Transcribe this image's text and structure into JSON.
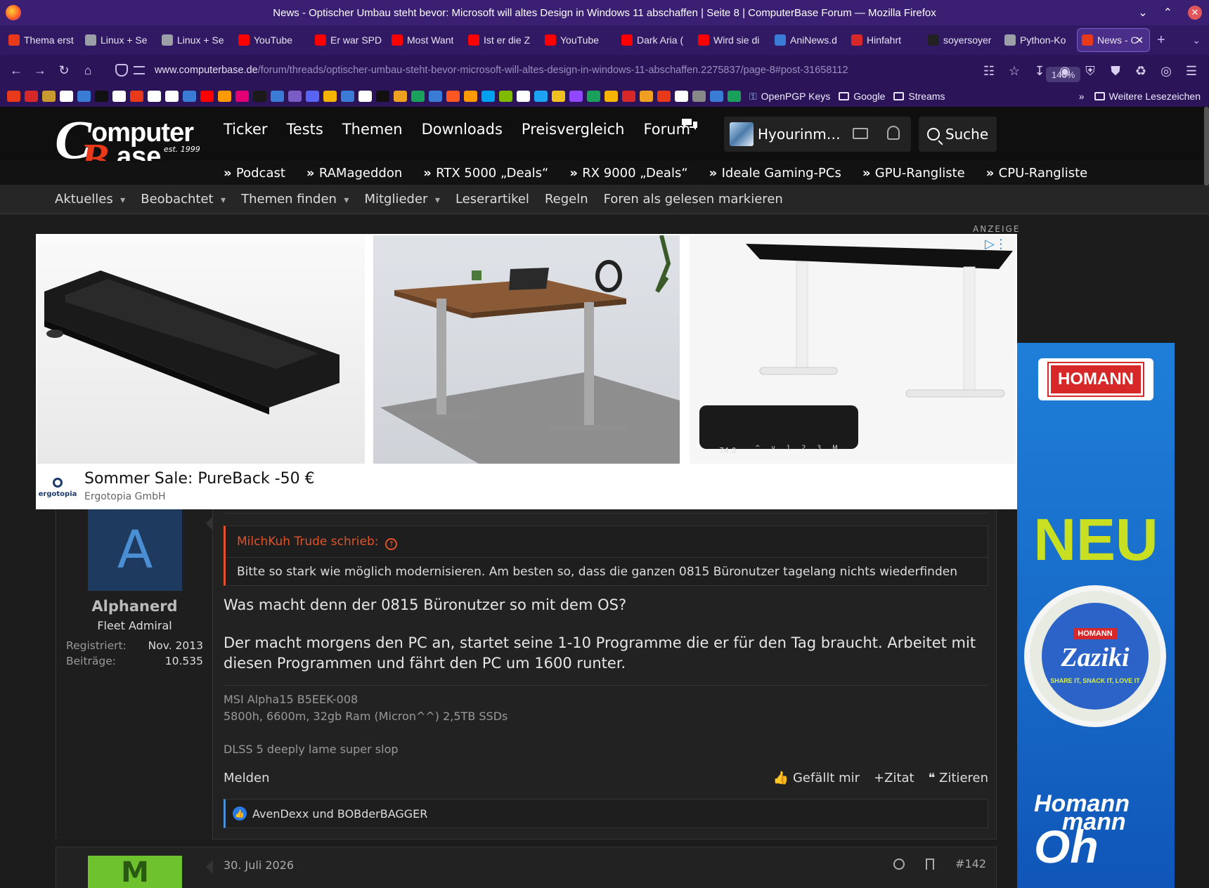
{
  "window": {
    "title": "News - Optischer Umbau steht bevor: Microsoft will altes Design in Windows 11 abschaffen | Seite 8 | ComputerBase Forum — Mozilla Firefox"
  },
  "tabs": [
    {
      "label": "Thema erst",
      "color": "#e83a1a"
    },
    {
      "label": "Linux + Se",
      "color": "#9aa0a6"
    },
    {
      "label": "Linux + Se",
      "color": "#9aa0a6"
    },
    {
      "label": "YouTube",
      "color": "#ff0000"
    },
    {
      "label": "Er war SPD",
      "color": "#ff0000"
    },
    {
      "label": "Most Want",
      "color": "#ff0000"
    },
    {
      "label": "Ist er die Z",
      "color": "#ff0000"
    },
    {
      "label": "YouTube",
      "color": "#ff0000"
    },
    {
      "label": "Dark Aria (",
      "color": "#ff0000"
    },
    {
      "label": "Wird sie di",
      "color": "#ff0000"
    },
    {
      "label": "AniNews.d",
      "color": "#3a7bd5"
    },
    {
      "label": "Hinfahrt",
      "color": "#d62828"
    },
    {
      "label": "soyersoyer",
      "color": "#222222"
    },
    {
      "label": "Python-Ko",
      "color": "#9aa0a6"
    },
    {
      "label": "News - C",
      "color": "#e83a1a",
      "active": true
    }
  ],
  "url": {
    "domain": "www.computerbase.de",
    "path": "/forum/threads/optischer-umbau-steht-bevor-microsoft-will-altes-design-in-windows-11-abschaffen.2275837/page-8#post-31658112",
    "zoom": "140%"
  },
  "bookmarks": {
    "items": [
      "OpenPGP Keys",
      "Google",
      "Streams"
    ],
    "more": "Weitere Lesezeichen",
    "icon_colors": [
      "#e83a1a",
      "#d62828",
      "#c99a2e",
      "#ffffff",
      "#3a7bd5",
      "#111111",
      "#ffffff",
      "#e83a1a",
      "#ffffff",
      "#ffffff",
      "#3a7bd5",
      "#ff0000",
      "#ff9900",
      "#e20074",
      "#1a1a1a",
      "#3a7bd5",
      "#7a5cc4",
      "#5865f2",
      "#f4b400",
      "#3a7bd5",
      "#ffffff",
      "#111111",
      "#f0a020",
      "#19a05a",
      "#3a7bd5",
      "#ff5722",
      "#ff9900",
      "#00a1f1",
      "#7fba00",
      "#ffffff",
      "#1da1f2",
      "#f0c020",
      "#9146ff",
      "#19a05a",
      "#f4b400",
      "#d62828",
      "#f0a020",
      "#e83a1a",
      "#ffffff",
      "#888888",
      "#3a7bd5",
      "#19a05a"
    ]
  },
  "site": {
    "logo": {
      "c": "C",
      "omputer": "omputer",
      "b": "B",
      "ase": "ase",
      "est": "est. 1999"
    },
    "nav": [
      "Ticker",
      "Tests",
      "Themen",
      "Downloads",
      "Preisvergleich",
      "Forum"
    ],
    "user": "Hyourinm…",
    "search": "Suche",
    "subnav": [
      "Podcast",
      "RAMageddon",
      "RTX 5000 „Deals“",
      "RX 9000 „Deals“",
      "Ideale Gaming-PCs",
      "GPU-Rangliste",
      "CPU-Rangliste"
    ],
    "forumnav": [
      {
        "label": "Aktuelles",
        "dd": true
      },
      {
        "label": "Beobachtet",
        "dd": true
      },
      {
        "label": "Themen finden",
        "dd": true
      },
      {
        "label": "Mitglieder",
        "dd": true
      },
      {
        "label": "Leserartikel",
        "dd": false
      },
      {
        "label": "Regeln",
        "dd": false
      },
      {
        "label": "Foren als gelesen markieren",
        "dd": false
      }
    ]
  },
  "ad": {
    "label": "ANZEIGE",
    "title": "Sommer Sale: PureBack -50 €",
    "advertiser": "Ergotopia GmbH",
    "logo": "ergotopia",
    "display_value": "74.0",
    "keys": [
      "^",
      "v",
      "1",
      "2",
      "3",
      "M"
    ]
  },
  "sidead": {
    "brand": "HOMANN",
    "headline": "NEU",
    "product_brand": "HOMANN",
    "product": "Zaziki",
    "slogan": "SHARE IT, SNACK IT, LOVE IT",
    "footer1": "Homann",
    "footer2": "mann",
    "footer3": "Oh"
  },
  "post": {
    "avatar_letter": "A",
    "author": "Alphanerd",
    "rank": "Fleet Admiral",
    "registered_label": "Registriert:",
    "registered": "Nov. 2013",
    "posts_label": "Beiträge:",
    "posts": "10.535",
    "quote_author": "MilchKuh Trude schrieb:",
    "quote_text": "Bitte so stark wie möglich modernisieren. Am besten so, dass die ganzen 0815 Büronutzer tagelang nichts wiederfinden",
    "message1": "Was macht denn der 0815 Büronutzer so mit dem OS?",
    "message2": "Der macht morgens den PC an, startet seine 1-10 Programme die er für den Tag braucht. Arbeitet mit diesen Programmen und fährt den PC um 1600 runter.",
    "sig1": "MSI Alpha15 B5EEK-008",
    "sig2": "5800h, 6600m, 32gb Ram (Micron^^) 2,5TB SSDs",
    "sig3": "DLSS 5 deeply lame super slop",
    "report": "Melden",
    "like": "Gefällt mir",
    "zitat": "Zitat",
    "zitieren": "Zitieren",
    "likes": "AvenDexx und BOBderBAGGER"
  },
  "post2": {
    "avatar_letter": "M",
    "date": "30. Juli 2026",
    "number": "#142"
  }
}
